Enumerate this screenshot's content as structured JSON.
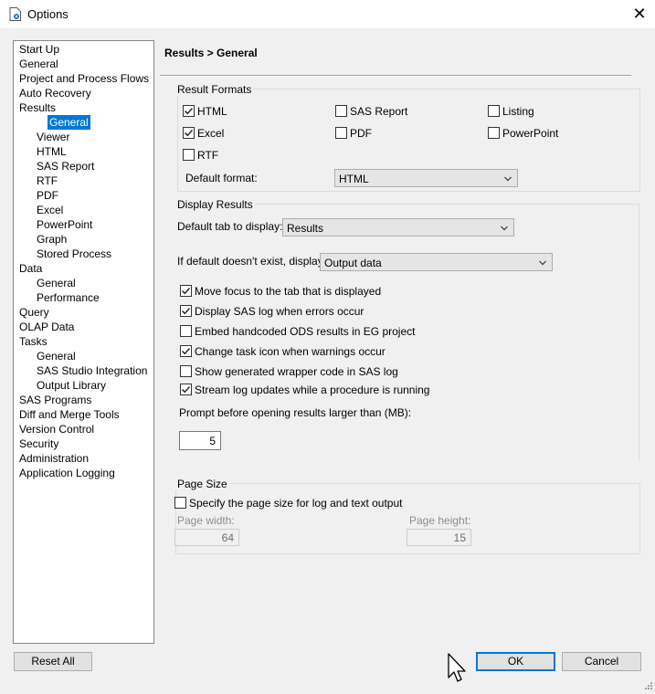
{
  "window": {
    "title": "Options",
    "close_glyph": "✕",
    "icon": "options-app-icon"
  },
  "tree": {
    "items": [
      {
        "label": "Start Up",
        "level": 0
      },
      {
        "label": "General",
        "level": 0
      },
      {
        "label": "Project and Process Flows",
        "level": 0
      },
      {
        "label": "Auto Recovery",
        "level": 0
      },
      {
        "label": "Results",
        "level": 0
      },
      {
        "label": "General",
        "level": 1,
        "selected": true
      },
      {
        "label": "Viewer",
        "level": 1
      },
      {
        "label": "HTML",
        "level": 1
      },
      {
        "label": "SAS Report",
        "level": 1
      },
      {
        "label": "RTF",
        "level": 1
      },
      {
        "label": "PDF",
        "level": 1
      },
      {
        "label": "Excel",
        "level": 1
      },
      {
        "label": "PowerPoint",
        "level": 1
      },
      {
        "label": "Graph",
        "level": 1
      },
      {
        "label": "Stored Process",
        "level": 1
      },
      {
        "label": "Data",
        "level": 0
      },
      {
        "label": "General",
        "level": 1
      },
      {
        "label": "Performance",
        "level": 1
      },
      {
        "label": "Query",
        "level": 0
      },
      {
        "label": "OLAP Data",
        "level": 0
      },
      {
        "label": "Tasks",
        "level": 0
      },
      {
        "label": "General",
        "level": 1
      },
      {
        "label": "SAS Studio Integration",
        "level": 1
      },
      {
        "label": "Output Library",
        "level": 1
      },
      {
        "label": "SAS Programs",
        "level": 0
      },
      {
        "label": "Diff and Merge Tools",
        "level": 0
      },
      {
        "label": "Version Control",
        "level": 0
      },
      {
        "label": "Security",
        "level": 0
      },
      {
        "label": "Administration",
        "level": 0
      },
      {
        "label": "Application Logging",
        "level": 0
      }
    ]
  },
  "page": {
    "heading": "Results > General"
  },
  "result_formats": {
    "title": "Result Formats",
    "html": {
      "label": "HTML",
      "checked": true
    },
    "sas_report": {
      "label": "SAS Report",
      "checked": false
    },
    "listing": {
      "label": "Listing",
      "checked": false
    },
    "excel": {
      "label": "Excel",
      "checked": true
    },
    "pdf": {
      "label": "PDF",
      "checked": false
    },
    "powerpoint": {
      "label": "PowerPoint",
      "checked": false
    },
    "rtf": {
      "label": "RTF",
      "checked": false
    },
    "default_format_label": "Default format:",
    "default_format_value": "HTML"
  },
  "display_results": {
    "title": "Display Results",
    "default_tab_label": "Default tab to display:",
    "default_tab_value": "Results",
    "if_not_exist_label": "If default doesn't exist, display:",
    "if_not_exist_value": "Output data",
    "options": [
      {
        "label": "Move focus to the tab that is displayed",
        "checked": true
      },
      {
        "label": "Display SAS log when errors occur",
        "checked": true
      },
      {
        "label": "Embed handcoded ODS results in EG project",
        "checked": false
      },
      {
        "label": "Change task icon when warnings occur",
        "checked": true
      },
      {
        "label": "Show generated wrapper code in SAS log",
        "checked": false
      },
      {
        "label": "Stream log updates while a procedure is running",
        "checked": true
      }
    ],
    "prompt_label": "Prompt before opening results larger than (MB):",
    "prompt_value": "5"
  },
  "page_size": {
    "title": "Page Size",
    "specify_label": "Specify the page size for log and text output",
    "specify_checked": false,
    "width_label": "Page width:",
    "width_value": "64",
    "height_label": "Page height:",
    "height_value": "15"
  },
  "buttons": {
    "reset_all": "Reset All",
    "ok": "OK",
    "cancel": "Cancel"
  },
  "colors": {
    "selection": "#0078d7",
    "background": "#f0f0f0"
  }
}
